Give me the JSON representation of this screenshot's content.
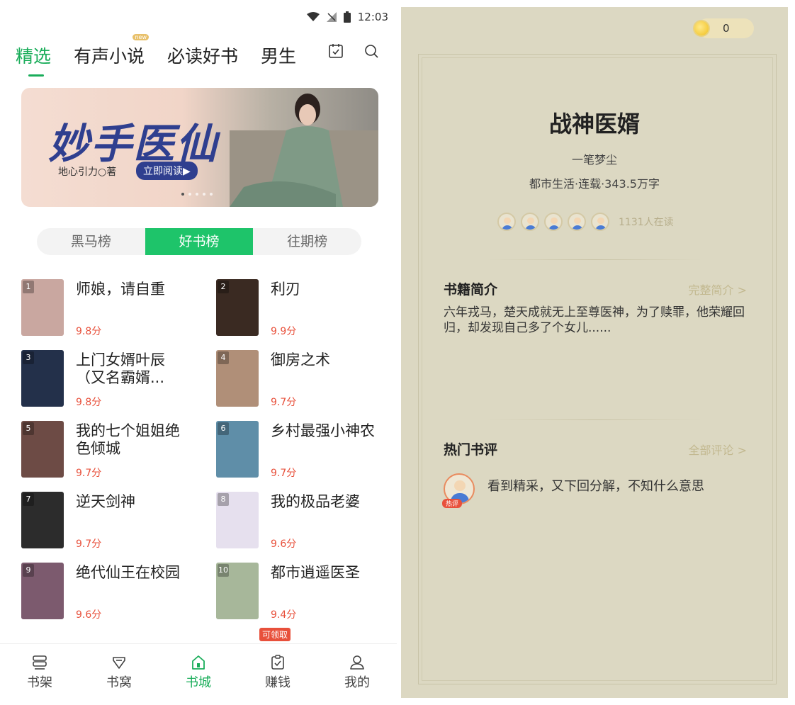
{
  "status_bar": {
    "time": "12:03"
  },
  "nav": {
    "tabs": [
      {
        "label": "精选",
        "active": true
      },
      {
        "label": "有声小说",
        "badge": "new"
      },
      {
        "label": "必读好书"
      },
      {
        "label": "男生"
      }
    ]
  },
  "banner": {
    "title": "妙手医仙",
    "author": "地心引力○著",
    "read_button": "立即阅读▶"
  },
  "rank_tabs": [
    {
      "label": "黑马榜"
    },
    {
      "label": "好书榜",
      "active": true
    },
    {
      "label": "往期榜"
    }
  ],
  "books": [
    {
      "rank": "1",
      "title": "师娘，请自重",
      "score": "9.8分",
      "cover_color": "#c9a7a0"
    },
    {
      "rank": "2",
      "title": "利刃",
      "score": "9.9分",
      "cover_color": "#3a2a22"
    },
    {
      "rank": "3",
      "title": "上门女婿叶辰（又名霸婿...",
      "score": "9.8分",
      "cover_color": "#23304a"
    },
    {
      "rank": "4",
      "title": "御房之术",
      "score": "9.7分",
      "cover_color": "#b08f78"
    },
    {
      "rank": "5",
      "title": "我的七个姐姐绝色倾城",
      "score": "9.7分",
      "cover_color": "#6d4b45"
    },
    {
      "rank": "6",
      "title": "乡村最强小神农",
      "score": "9.7分",
      "cover_color": "#5f8ea8"
    },
    {
      "rank": "7",
      "title": "逆天剑神",
      "score": "9.7分",
      "cover_color": "#2c2c2c"
    },
    {
      "rank": "8",
      "title": "我的极品老婆",
      "score": "9.6分",
      "cover_color": "#e6e0ee"
    },
    {
      "rank": "9",
      "title": "绝代仙王在校园",
      "score": "9.6分",
      "cover_color": "#7c5a6e"
    },
    {
      "rank": "10",
      "title": "都市逍遥医圣",
      "score": "9.4分",
      "cover_color": "#a7b79a"
    }
  ],
  "claim_badge": "可领取",
  "bottom_nav": [
    {
      "label": "书架",
      "icon": "bookshelf-icon"
    },
    {
      "label": "书窝",
      "icon": "shield-heart-icon"
    },
    {
      "label": "书城",
      "icon": "home-icon",
      "active": true
    },
    {
      "label": "赚钱",
      "icon": "clipboard-check-icon"
    },
    {
      "label": "我的",
      "icon": "user-icon"
    }
  ],
  "detail": {
    "coins": "0",
    "title": "战神医婿",
    "author": "一笔梦尘",
    "meta": "都市生活·连载·343.5万字",
    "readers": "1131人在读",
    "intro_heading": "书籍简介",
    "intro_link": "完整简介 >",
    "intro": "六年戎马，楚天成就无上至尊医神，为了赎罪，他荣耀回归，却发现自己多了个女儿......",
    "reviews_heading": "热门书评",
    "reviews_link": "全部评论 >",
    "review_tag": "热评",
    "review_text": "看到精采，又下回分解，不知什么意思"
  },
  "colors": {
    "accent": "#1aad5a",
    "score": "#e8503b",
    "detail_bg": "#dcd8c2"
  }
}
